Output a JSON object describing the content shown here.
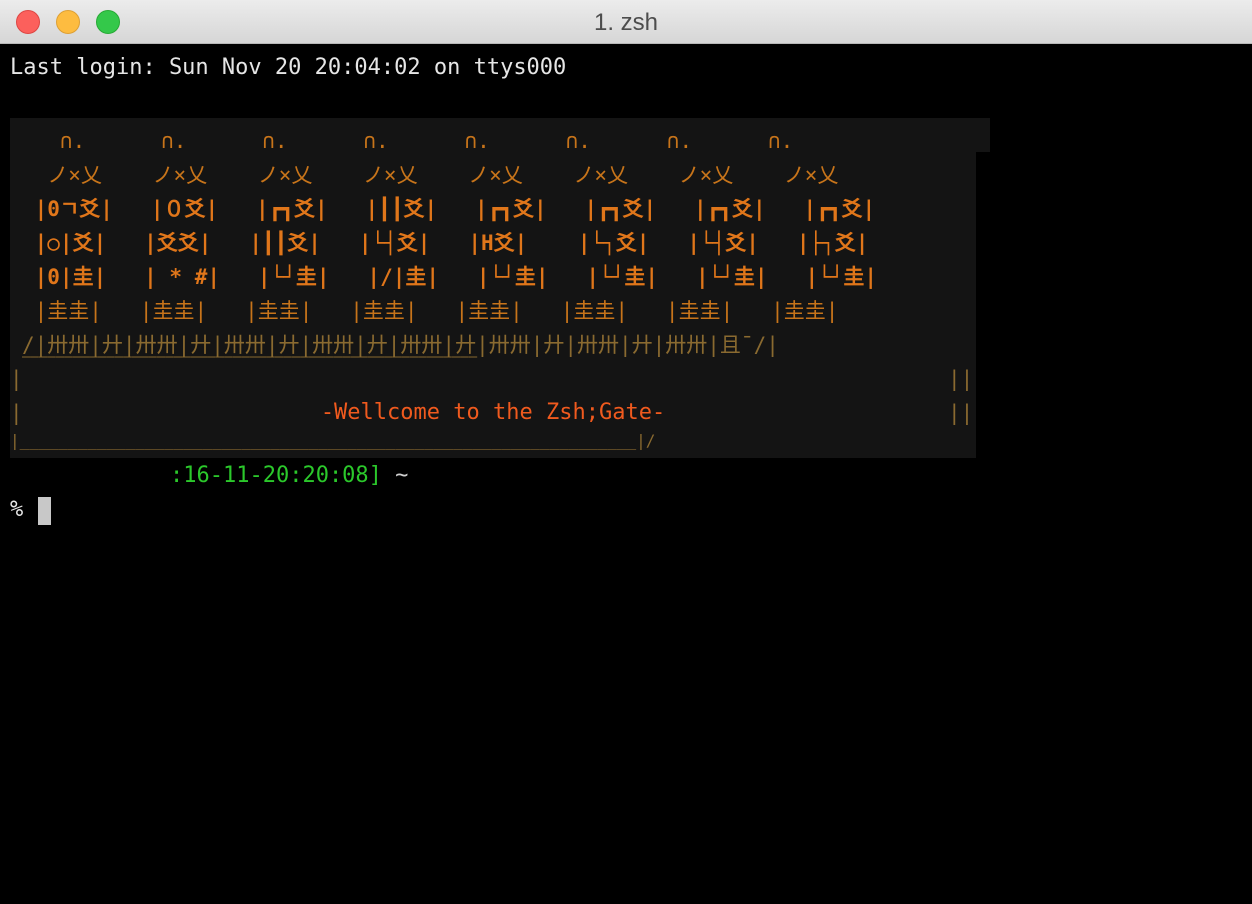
{
  "window": {
    "title": "1. zsh",
    "controls": [
      "close",
      "minimize",
      "zoom"
    ]
  },
  "terminal": {
    "last_login": "Last login: Sun Nov 20 20:04:02 on ttys000",
    "banner": {
      "rows": [
        "   ∩.      ∩.      ∩.      ∩.      ∩.      ∩.      ∩.      ∩.",
        "  ノ×乂    ノ×乂    ノ×乂    ノ×乂    ノ×乂    ノ×乂    ノ×乂    ノ×乂",
        " |0ㄱ爻|   |０爻|   |┏┓爻|   |┃┃爻|   |┏┓爻|   |┏┓爻|   |┏┓爻|   |┏┓爻|",
        " |○|爻|   |爻爻|   |┃┃爻|   |└┤爻|   |H爻|    |└┐爻|   |└┤爻|   |├┐爻|",
        " |0|圭|   | * #|   |└┘圭|   |/|圭|   |└┘圭|   |└┘圭|   |└┘圭|   |└┘圭|",
        " |圭圭|   |圭圭|   |圭圭|   |圭圭|   |圭圭|   |圭圭|   |圭圭|   |圭圭|"
      ],
      "wall": "/|卅卅|廾|卅卅|廾|卅卅|廾|卅卅|廾|卅卅|廾|卅卅|廾|卅卅|廾|卅卅|且¯/|",
      "top_rule": "——————————————————————————————————————————————————————",
      "side_left": "|",
      "side_right": "||",
      "welcome": "-Wellcome to the Zsh;Gate-",
      "bottom_rule": "|________________________________________________________________|/"
    },
    "prompt": {
      "timestamp": ":16-11-20:20:08]",
      "cwd": "~",
      "symbol": "%"
    },
    "colors": {
      "background": "#000000",
      "banner_bg": "#141414",
      "art": "#c7741a",
      "welcome": "#f05a1e",
      "prompt_green": "#2bc82b"
    }
  }
}
